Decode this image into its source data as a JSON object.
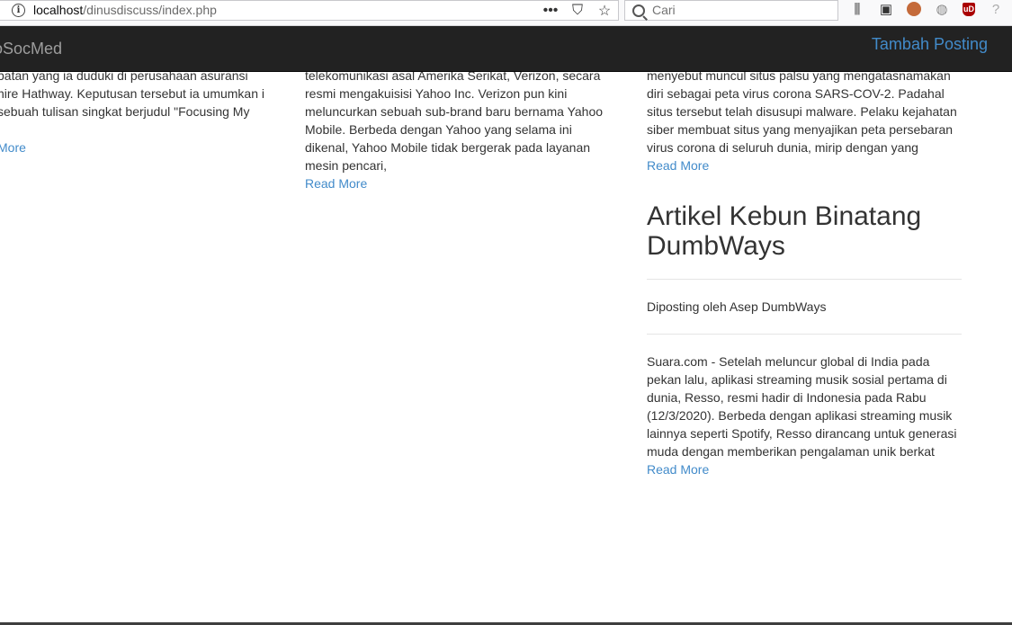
{
  "browser": {
    "url_host": "localhost",
    "url_path": "/dinusdiscuss/index.php",
    "search_placeholder": "Cari",
    "actions": {
      "more": "•••",
      "pocket": "⛉",
      "bookmark": "☆"
    },
    "tools": {
      "library": "⫼",
      "sidebar": "▣",
      "globe": "◍",
      "ublock": "uD",
      "last": "?"
    }
  },
  "navbar": {
    "brand": "oSocMed",
    "link": "Tambah Posting"
  },
  "posts": [
    {
      "body": "batan yang ia duduki di perusahaan asuransi hire Hathway. Keputusan tersebut ia umumkan i sebuah tulisan singkat berjudul \"Focusing My",
      "read_more": "More"
    },
    {
      "body_partial": "telekomunikasi asal Amerika Serikat, Verizon, secara",
      "body": "resmi mengakuisisi Yahoo Inc. Verizon pun kini meluncurkan sebuah sub-brand baru bernama Yahoo Mobile. Berbeda dengan Yahoo yang selama ini dikenal, Yahoo Mobile tidak bergerak pada layanan mesin pencari,",
      "read_more": "Read More"
    },
    {
      "body_partial": "menyebut muncul situs palsu yang mengatasnamakan",
      "body": "diri sebagai peta virus corona SARS-COV-2. Padahal situs tersebut telah disusupi malware. Pelaku kejahatan siber membuat situs yang menyajikan peta persebaran virus corona di seluruh dunia, mirip dengan yang",
      "read_more": "Read More"
    },
    {
      "title": "Artikel Kebun Binatang DumbWays",
      "author": "Diposting oleh Asep DumbWays",
      "body": "Suara.com - Setelah meluncur global di India pada pekan lalu, aplikasi streaming musik sosial pertama di dunia, Resso, resmi hadir di Indonesia pada Rabu (12/3/2020). Berbeda dengan aplikasi streaming musik lainnya seperti Spotify, Resso dirancang untuk generasi muda dengan memberikan pengalaman unik berkat",
      "read_more": "Read More"
    }
  ],
  "colors": {
    "navbar_bg": "#222222",
    "brand": "#9d9d9d",
    "link": "#428bca",
    "text": "#333333"
  }
}
